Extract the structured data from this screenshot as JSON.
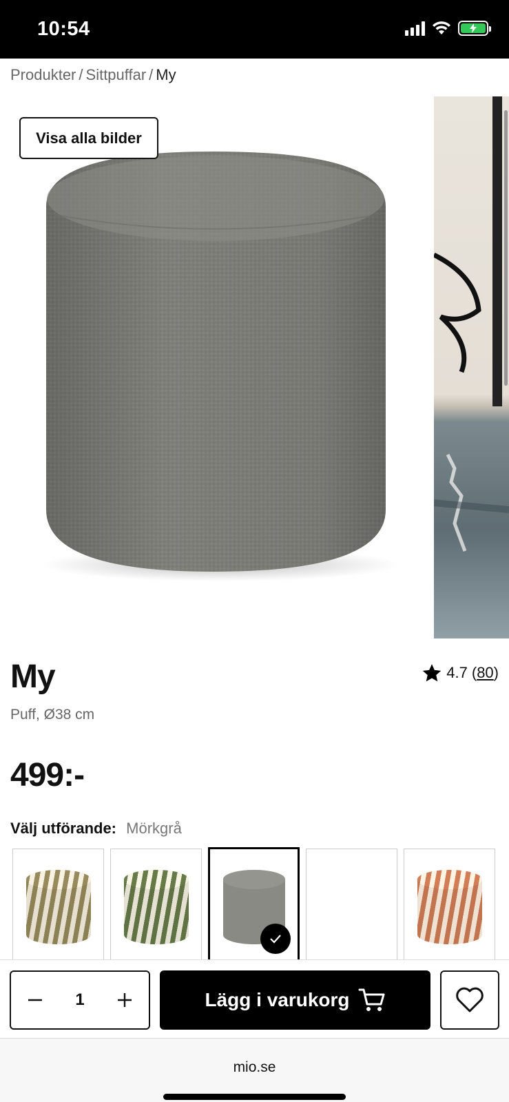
{
  "status_bar": {
    "time": "10:54"
  },
  "breadcrumb": {
    "items": [
      "Produkter",
      "Sittpuffar",
      "My"
    ],
    "separator": "/"
  },
  "gallery": {
    "show_all_label": "Visa alla bilder"
  },
  "product": {
    "title": "My",
    "subtitle": "Puff, Ø38 cm",
    "price": "499:-",
    "rating": {
      "score": "4.7",
      "count": "80"
    }
  },
  "variant_picker": {
    "label": "Välj utförande:",
    "selected_value": "Mörkgrå",
    "options": [
      {
        "style": "zebra-olive",
        "selected": false
      },
      {
        "style": "zebra-green",
        "selected": false
      },
      {
        "style": "gray",
        "selected": true
      },
      {
        "style": "empty",
        "selected": false
      },
      {
        "style": "zebra-rust",
        "selected": false
      }
    ]
  },
  "cart": {
    "quantity": "1",
    "add_label": "Lägg i varukorg"
  },
  "browser": {
    "url": "mio.se"
  },
  "colors": {
    "accent": "#000000",
    "battery": "#34c759",
    "product_gray": "#7f7f7a"
  },
  "icons": [
    "signal-icon",
    "wifi-icon",
    "battery-icon",
    "star-icon",
    "cart-icon",
    "heart-icon",
    "minus-icon",
    "plus-icon",
    "check-icon"
  ]
}
